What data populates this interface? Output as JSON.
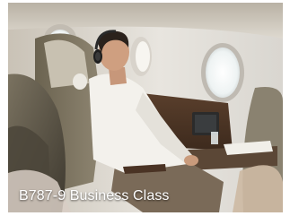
{
  "photo": {
    "description_icon": "airplane-cabin-photo",
    "caption": "B787-9 Business Class"
  }
}
